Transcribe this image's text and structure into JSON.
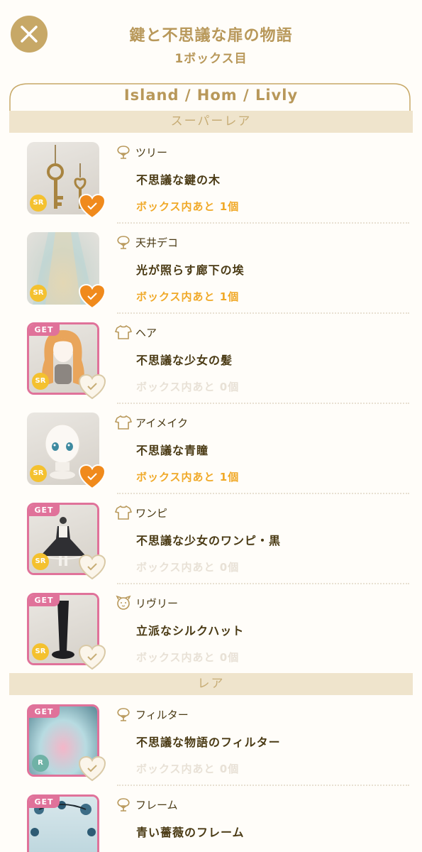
{
  "header": {
    "title": "鍵と不思議な扉の物語",
    "subtitle": "1ボックス目",
    "close_icon": "close-icon"
  },
  "tab": {
    "label": "Island / Hom / Livly"
  },
  "sections": {
    "super_rare": "スーパーレア",
    "rare": "レア"
  },
  "colors": {
    "gold": "#b8985a",
    "orange": "#f0a928",
    "heart_active": "#f08a1c",
    "get_pink": "#e0729a"
  },
  "items": [
    {
      "category": "ツリー",
      "name": "不思議な鍵の木",
      "remaining": "ボックス内あと 1個",
      "rarity": "SR",
      "got": false,
      "get": "",
      "icon": "tree-icon"
    },
    {
      "category": "天井デコ",
      "name": "光が照らす廊下の埃",
      "remaining": "ボックス内あと 1個",
      "rarity": "SR",
      "got": false,
      "get": "",
      "icon": "tree-icon"
    },
    {
      "category": "ヘア",
      "name": "不思議な少女の髪",
      "remaining": "ボックス内あと 0個",
      "rarity": "SR",
      "got": true,
      "get": "GET",
      "icon": "shirt-icon"
    },
    {
      "category": "アイメイク",
      "name": "不思議な青瞳",
      "remaining": "ボックス内あと 1個",
      "rarity": "SR",
      "got": false,
      "get": "",
      "icon": "shirt-icon"
    },
    {
      "category": "ワンピ",
      "name": "不思議な少女のワンピ・黒",
      "remaining": "ボックス内あと 0個",
      "rarity": "SR",
      "got": true,
      "get": "GET",
      "icon": "shirt-icon"
    },
    {
      "category": "リヴリー",
      "name": "立派なシルクハット",
      "remaining": "ボックス内あと 0個",
      "rarity": "SR",
      "got": true,
      "get": "GET",
      "icon": "livly-icon"
    },
    {
      "category": "フィルター",
      "name": "不思議な物語のフィルター",
      "remaining": "ボックス内あと 0個",
      "rarity": "R",
      "got": true,
      "get": "GET",
      "icon": "tree-icon"
    },
    {
      "category": "フレーム",
      "name": "青い薔薇のフレーム",
      "remaining": "",
      "rarity": "R",
      "got": true,
      "get": "GET",
      "icon": "tree-icon"
    }
  ]
}
